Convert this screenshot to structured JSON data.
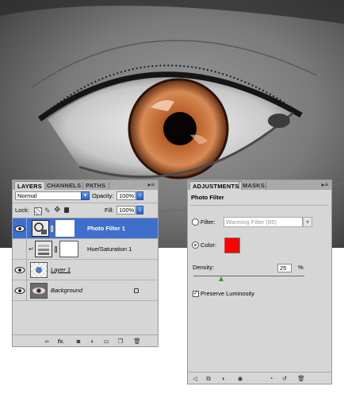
{
  "photo": {
    "alt_name": "eye-photo"
  },
  "layers_panel": {
    "tabs": [
      "LAYERS",
      "CHANNELS",
      "PATHS"
    ],
    "blend_mode": "Normal",
    "opacity_label": "Opacity:",
    "opacity_value": "100%",
    "lock_label": "Lock:",
    "fill_label": "Fill:",
    "fill_value": "100%",
    "layers": [
      {
        "name": "Photo Filter 1",
        "selected": true
      },
      {
        "name": "Hue/Saturation 1",
        "selected": false
      },
      {
        "name": "Layer 1",
        "selected": false
      },
      {
        "name": "Background",
        "selected": false
      }
    ],
    "bottom_icons": [
      "link-icon",
      "fx-icon",
      "mask-icon",
      "adjustment-icon",
      "folder-icon",
      "new-layer-icon",
      "trash-icon"
    ],
    "fx_text": "fx."
  },
  "adjustments_panel": {
    "tabs": [
      "ADJUSTMENTS",
      "MASKS"
    ],
    "title": "Photo Filter",
    "filter_label": "Filter:",
    "filter_value": "Warming Filter (85)",
    "color_label": "Color:",
    "color_swatch": "#ff0000",
    "density_label": "Density:",
    "density_value": "25",
    "density_unit": "%",
    "density_fraction": 0.25,
    "preserve_label": "Preserve Luminosity",
    "preserve_checked": true,
    "bottom_icons": [
      "back-arrow-icon",
      "clip-icon",
      "visibility-icon",
      "eye-icon",
      "previous-state-icon",
      "reset-icon",
      "trash-icon"
    ]
  },
  "colors": {
    "selection_blue": "#3d6fcb",
    "panel_gray": "#d6d6d6",
    "iris": "#c26a3a"
  }
}
